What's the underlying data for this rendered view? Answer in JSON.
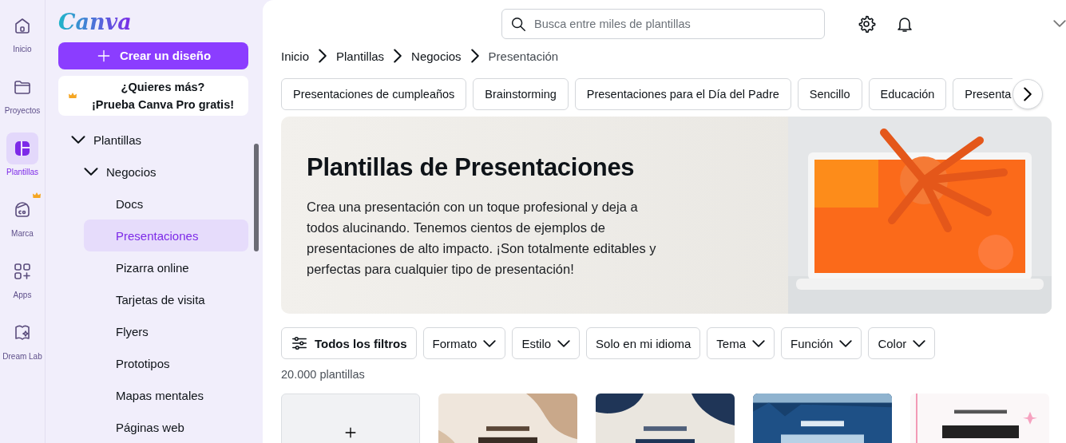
{
  "rail": {
    "items": [
      {
        "label": "Inicio",
        "selected": false,
        "premium": false
      },
      {
        "label": "Proyectos",
        "selected": false,
        "premium": false
      },
      {
        "label": "Plantillas",
        "selected": true,
        "premium": false
      },
      {
        "label": "Marca",
        "selected": false,
        "premium": true
      },
      {
        "label": "Apps",
        "selected": false,
        "premium": false
      },
      {
        "label": "Dream Lab",
        "selected": false,
        "premium": false
      }
    ]
  },
  "sidebar": {
    "logo": "Canva",
    "create_button": "Crear un diseño",
    "promo": [
      "¿Quieres más?",
      "¡Prueba Canva Pro gratis!"
    ],
    "tree": [
      {
        "label": "Plantillas",
        "expanded": true,
        "children": [
          {
            "label": "Negocios",
            "expanded": true,
            "children": [
              {
                "label": "Docs",
                "selected": false
              },
              {
                "label": "Presentaciones",
                "selected": true
              },
              {
                "label": "Pizarra online",
                "selected": false
              },
              {
                "label": "Tarjetas de visita",
                "selected": false
              },
              {
                "label": "Flyers",
                "selected": false
              },
              {
                "label": "Prototipos",
                "selected": false
              },
              {
                "label": "Mapas mentales",
                "selected": false
              },
              {
                "label": "Páginas web",
                "selected": false
              }
            ]
          }
        ]
      }
    ]
  },
  "main": {
    "search": {
      "placeholder": "Busca entre miles de plantillas"
    },
    "breadcrumb": [
      "Inicio",
      "Plantillas",
      "Negocios",
      "Presentación"
    ],
    "chips": [
      "Presentaciones de cumpleaños",
      "Brainstorming",
      "Presentaciones para el Día del Padre",
      "Sencillo",
      "Educación",
      "Presenta"
    ],
    "hero": {
      "title": "Plantillas de Presentaciones",
      "description": "Crea una presentación con un toque profesional y deja a todos alucinando. Tenemos cientos de ejemplos de presentaciones de alto impacto. ¡Son totalmente editables y perfectas para cualquier tipo de presentación!",
      "image": {
        "kind": "picture"
      }
    },
    "filters": [
      {
        "label": "Todos los filtros",
        "kind": "all"
      },
      {
        "label": "Formato",
        "kind": "dropdown"
      },
      {
        "label": "Estilo",
        "kind": "dropdown"
      },
      {
        "label": "Solo en mi idioma",
        "kind": "toggle"
      },
      {
        "label": "Tema",
        "kind": "dropdown"
      },
      {
        "label": "Función",
        "kind": "dropdown"
      },
      {
        "label": "Color",
        "kind": "dropdown"
      }
    ],
    "count": "20.000 plantillas",
    "templates": [
      {
        "kind": "create"
      },
      {
        "kind": "picture"
      },
      {
        "kind": "picture"
      },
      {
        "kind": "picture"
      },
      {
        "kind": "picture"
      }
    ]
  }
}
